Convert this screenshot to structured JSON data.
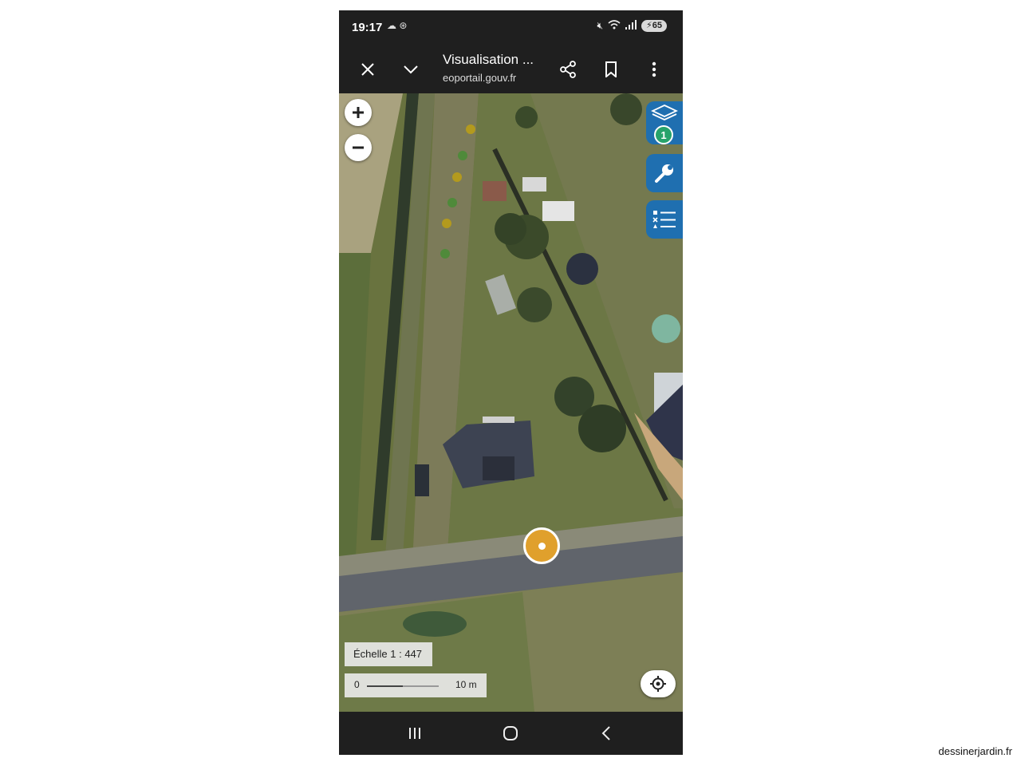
{
  "status_bar": {
    "time": "19:17",
    "left_icons": [
      "cloud-icon",
      "app-icon"
    ],
    "right_icons": [
      "mute-icon",
      "wifi-icon",
      "signal-icon"
    ],
    "battery": "65"
  },
  "toolbar": {
    "title": "Visualisation ...",
    "url": "eoportail.gouv.fr",
    "icons": [
      "close-icon",
      "chevron-down-icon",
      "share-icon",
      "bookmark-icon",
      "more-vert-icon"
    ]
  },
  "map": {
    "zoom_in": "zoom-in-icon",
    "zoom_out": "zoom-out-icon",
    "layers_count": "1",
    "scale_label": "Échelle 1 : 447",
    "scale_bar_start": "0",
    "scale_bar_distance": "10 m",
    "side_tools": [
      "layers-icon",
      "wrench-icon",
      "legend-list-icon"
    ],
    "colors": {
      "side_button": "#1f6fb0",
      "position_marker": "#e0a02c",
      "layers_badge": "#27a36b"
    }
  },
  "nav_bar": {
    "icons": [
      "recent-apps-icon",
      "home-icon",
      "back-icon"
    ]
  },
  "watermark": "dessinerjardin.fr"
}
